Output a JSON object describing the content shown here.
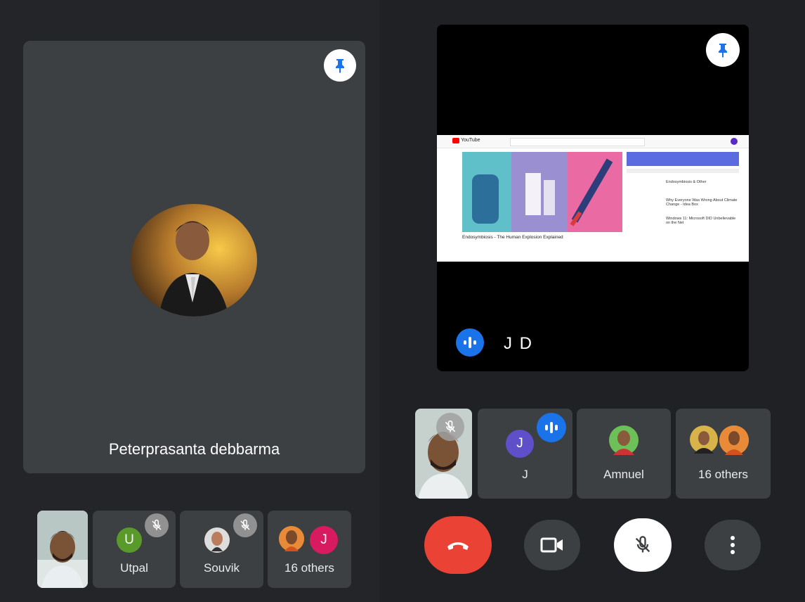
{
  "main_participant": {
    "name": "Peterprasanta debbarma"
  },
  "left_strip": [
    {
      "name": "Utpal",
      "initial": "U",
      "color": "#5a9a2b",
      "muted": true
    },
    {
      "name": "Souvik",
      "muted": true
    },
    {
      "name": "16 others",
      "initial": "J",
      "color": "#d81b60"
    }
  ],
  "presenter": {
    "name": "J D"
  },
  "right_strip": [
    {
      "name": "J",
      "initial": "J",
      "color": "#5f4fc9",
      "speaking": true
    },
    {
      "name": "Amnuel"
    },
    {
      "name": "16 others"
    }
  ],
  "screen_share": {
    "site": "YouTube",
    "video_title": "Endosymbiosis - The Human Explosion Explained",
    "sidebar_items": [
      "Endosymbiosis & Other",
      "Why Everyone Was Wrong About Climate Change - Idea Box",
      "Windows 11: Microsoft DID Unbelievable on the Net"
    ]
  },
  "controls": {
    "end_call_color": "#ea4335",
    "icons": [
      "end-call-icon",
      "camera-icon",
      "mic-off-icon",
      "more-vert-icon"
    ]
  },
  "colors": {
    "background": "#202124",
    "tile": "#3c4043",
    "accent": "#1a73e8"
  }
}
